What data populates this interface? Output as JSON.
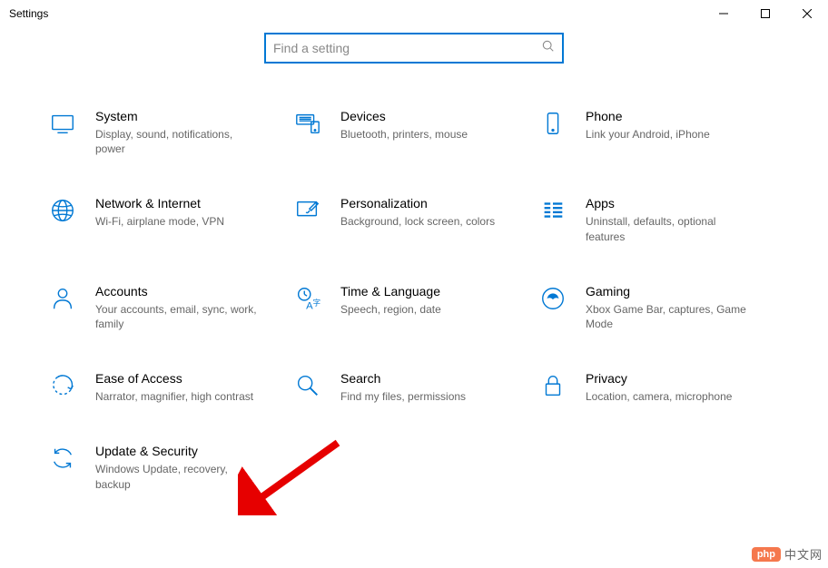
{
  "window": {
    "title": "Settings"
  },
  "search": {
    "placeholder": "Find a setting"
  },
  "tiles": [
    {
      "id": "system",
      "title": "System",
      "desc": "Display, sound, notifications, power"
    },
    {
      "id": "devices",
      "title": "Devices",
      "desc": "Bluetooth, printers, mouse"
    },
    {
      "id": "phone",
      "title": "Phone",
      "desc": "Link your Android, iPhone"
    },
    {
      "id": "network",
      "title": "Network & Internet",
      "desc": "Wi-Fi, airplane mode, VPN"
    },
    {
      "id": "personalization",
      "title": "Personalization",
      "desc": "Background, lock screen, colors"
    },
    {
      "id": "apps",
      "title": "Apps",
      "desc": "Uninstall, defaults, optional features"
    },
    {
      "id": "accounts",
      "title": "Accounts",
      "desc": "Your accounts, email, sync, work, family"
    },
    {
      "id": "time-language",
      "title": "Time & Language",
      "desc": "Speech, region, date"
    },
    {
      "id": "gaming",
      "title": "Gaming",
      "desc": "Xbox Game Bar, captures, Game Mode"
    },
    {
      "id": "ease-of-access",
      "title": "Ease of Access",
      "desc": "Narrator, magnifier, high contrast"
    },
    {
      "id": "search",
      "title": "Search",
      "desc": "Find my files, permissions"
    },
    {
      "id": "privacy",
      "title": "Privacy",
      "desc": "Location, camera, microphone"
    },
    {
      "id": "update-security",
      "title": "Update & Security",
      "desc": "Windows Update, recovery, backup"
    }
  ],
  "watermark": {
    "badge": "php",
    "text": "中文网"
  }
}
